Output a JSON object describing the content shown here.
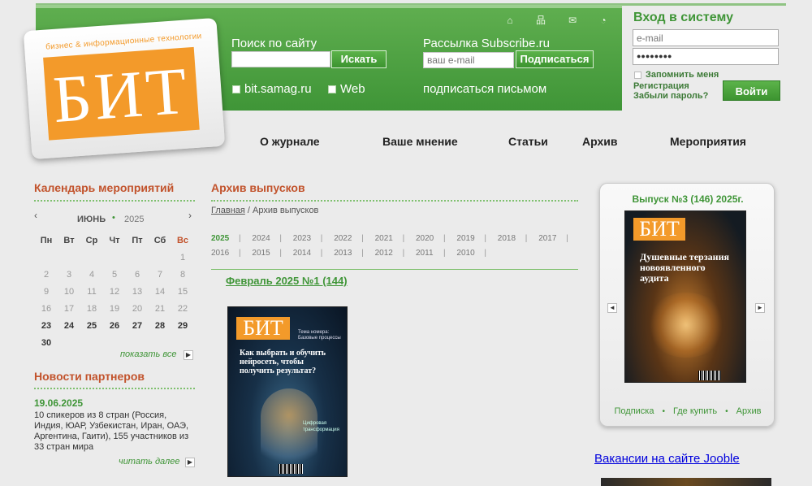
{
  "header": {
    "icons": [
      "home-icon",
      "sitemap-icon",
      "mail-icon",
      "rss-icon"
    ],
    "logo": {
      "letters": "БИТ",
      "tagline": "бизнес & информационные технологии"
    },
    "search": {
      "label": "Поиск по сайту",
      "placeholder": "",
      "button": "Искать",
      "options": [
        "bit.samag.ru",
        "Web"
      ]
    },
    "subscribe": {
      "label": "Рассылка Subscribe.ru",
      "placeholder": "ваш e-mail",
      "button": "Подписаться",
      "letter_link": "подписаться письмом"
    }
  },
  "login": {
    "title": "Вход в систему",
    "email_placeholder": "e-mail",
    "password_value": "●●●●●●●●",
    "remember_label": "Запомнить меня",
    "register_link": "Регистрация",
    "forgot_link": "Забыли пароль?",
    "submit": "Войти"
  },
  "nav": [
    "О журнале",
    "Ваше мнение",
    "Статьи",
    "Архив",
    "Мероприятия"
  ],
  "calendar": {
    "title": "Календарь мероприятий",
    "month": "ИЮНЬ",
    "year": "2025",
    "prev": "‹",
    "next": "›",
    "weekdays": [
      "Пн",
      "Вт",
      "Ср",
      "Чт",
      "Пт",
      "Сб",
      "Вс"
    ],
    "weeks": [
      [
        "",
        "",
        "",
        "",
        "",
        "",
        "1"
      ],
      [
        "2",
        "3",
        "4",
        "5",
        "6",
        "7",
        "8"
      ],
      [
        "9",
        "10",
        "11",
        "12",
        "13",
        "14",
        "15"
      ],
      [
        "16",
        "17",
        "18",
        "19",
        "20",
        "21",
        "22"
      ],
      [
        "23",
        "24",
        "25",
        "26",
        "27",
        "28",
        "29"
      ],
      [
        "30",
        "",
        "",
        "",
        "",
        "",
        ""
      ]
    ],
    "show_all": "показать все"
  },
  "partner_news": {
    "title": "Новости партнеров",
    "date": "19.06.2025",
    "text_lines": [
      "10 спикеров из 8 стран (Россия,",
      "Индия, ЮАР, Узбекистан, Иран, ОАЭ,",
      "Аргентина, Гаити), 155 участников из",
      "33 стран мира"
    ],
    "more": "читать далее"
  },
  "archive": {
    "title": "Архив выпусков",
    "breadcrumb_home": "Главная",
    "breadcrumb_current": " / Архив выпусков",
    "years_row1": [
      "2025",
      "2024",
      "2023",
      "2022",
      "2021",
      "2020",
      "2019",
      "2018",
      "2017"
    ],
    "years_row2": [
      "2016",
      "2015",
      "2014",
      "2013",
      "2012",
      "2011",
      "2010"
    ],
    "issue_link": "Февраль  2025 №1 (144)",
    "cover1": {
      "logo": "БИТ",
      "headline": [
        "Как выбрать и обучить",
        "нейросеть, чтобы",
        "получить результат?"
      ],
      "topics": [
        "Тема номера:",
        "Базовые процессы",
        "Цифровая",
        "трансформация"
      ]
    }
  },
  "current_issue": {
    "title": "Выпуск №3 (146) 2025г.",
    "cover": {
      "logo": "БИТ",
      "headline": [
        "Душевные терзания",
        "новоявленного",
        "аудита"
      ]
    },
    "links": [
      "Подписка",
      "Где купить",
      "Архив"
    ],
    "prev": "◄",
    "next": "►"
  },
  "jooble_link": "Вакансии на сайте Jooble",
  "colors": {
    "brand_green": "#3f9537",
    "accent_orange": "#f39a2a",
    "heading_red": "#c2532c"
  }
}
